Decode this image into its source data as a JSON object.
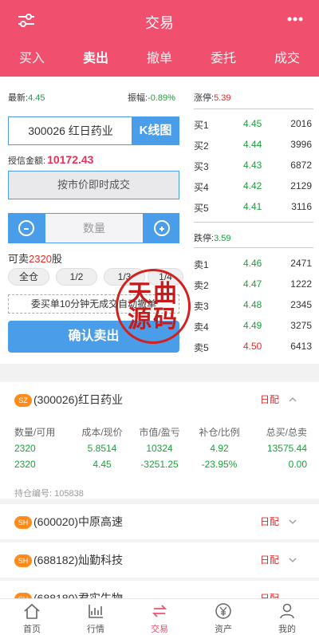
{
  "header": {
    "title": "交易",
    "menu_icon": "sliders-icon",
    "more_icon": "ellipsis-icon"
  },
  "tabs": [
    {
      "label": "买入",
      "active": false
    },
    {
      "label": "卖出",
      "active": true
    },
    {
      "label": "撤单",
      "active": false
    },
    {
      "label": "委托",
      "active": false
    },
    {
      "label": "成交",
      "active": false
    }
  ],
  "quote": {
    "latest_label": "最新:",
    "latest_value": "4.45",
    "amplitude_label": "振幅:",
    "amplitude_value": "-0.89%"
  },
  "order_form": {
    "stock_code_value": "300026 红日药业",
    "kline_label": "K线图",
    "credit_label": "授信金额:",
    "credit_value": "10172.43",
    "market_button": "按市价即时成交",
    "quantity_placeholder": "数量",
    "sellable_prefix": "可卖",
    "sellable_value": "2320",
    "sellable_suffix": "股",
    "ratios": [
      "全仓",
      "1/2",
      "1/3",
      "1/4"
    ],
    "notice": "委买单10分钟无成交自动撤单",
    "confirm_label": "确认卖出"
  },
  "order_book": {
    "limit_up_label": "涨停:",
    "limit_up_value": "5.39",
    "bids": [
      {
        "label": "买1",
        "price": "4.45",
        "volume": "2016"
      },
      {
        "label": "买2",
        "price": "4.44",
        "volume": "3996"
      },
      {
        "label": "买3",
        "price": "4.43",
        "volume": "6872"
      },
      {
        "label": "买4",
        "price": "4.42",
        "volume": "2129"
      },
      {
        "label": "买5",
        "price": "4.41",
        "volume": "3116"
      }
    ],
    "limit_down_label": "跌停:",
    "limit_down_value": "3.59",
    "asks": [
      {
        "label": "卖1",
        "price": "4.46",
        "volume": "2471"
      },
      {
        "label": "卖2",
        "price": "4.47",
        "volume": "1222"
      },
      {
        "label": "卖3",
        "price": "4.48",
        "volume": "2345"
      },
      {
        "label": "卖4",
        "price": "4.49",
        "volume": "3275"
      },
      {
        "label": "卖5",
        "price": "4.50",
        "volume": "6413"
      }
    ]
  },
  "seal": {
    "line1": "天曲",
    "line2": "源码"
  },
  "positions": {
    "headers": [
      "数量/可用",
      "成本/现价",
      "市值/盈亏",
      "补仓/比例",
      "总买/总卖"
    ],
    "expanded": {
      "badge": "SZ",
      "name": "(300026)红日药业",
      "tag": "日配",
      "row1": [
        "2320",
        "5.8514",
        "10324",
        "4.92",
        "13575.44"
      ],
      "row2": [
        "2320",
        "4.45",
        "-3251.25",
        "-23.95%",
        "0.00"
      ],
      "hold_no_label": "持仓编号:",
      "hold_no_value": "105838"
    },
    "collapsed": [
      {
        "badge": "SH",
        "name": "(600020)中原高速",
        "tag": "日配"
      },
      {
        "badge": "SH",
        "name": "(688182)灿勤科技",
        "tag": "日配"
      },
      {
        "badge": "SH",
        "name": "(688180)君实生物",
        "tag": "日配"
      }
    ]
  },
  "bottom_nav": [
    {
      "label": "首页",
      "icon": "home-icon",
      "active": false
    },
    {
      "label": "行情",
      "icon": "chart-icon",
      "active": false
    },
    {
      "label": "交易",
      "icon": "swap-icon",
      "active": true
    },
    {
      "label": "资产",
      "icon": "yen-icon",
      "active": false
    },
    {
      "label": "我的",
      "icon": "user-icon",
      "active": false
    }
  ],
  "colors": {
    "brand": "#f0506e",
    "accent": "#4a9de8",
    "up": "#e62a2a",
    "down": "#17a338"
  }
}
